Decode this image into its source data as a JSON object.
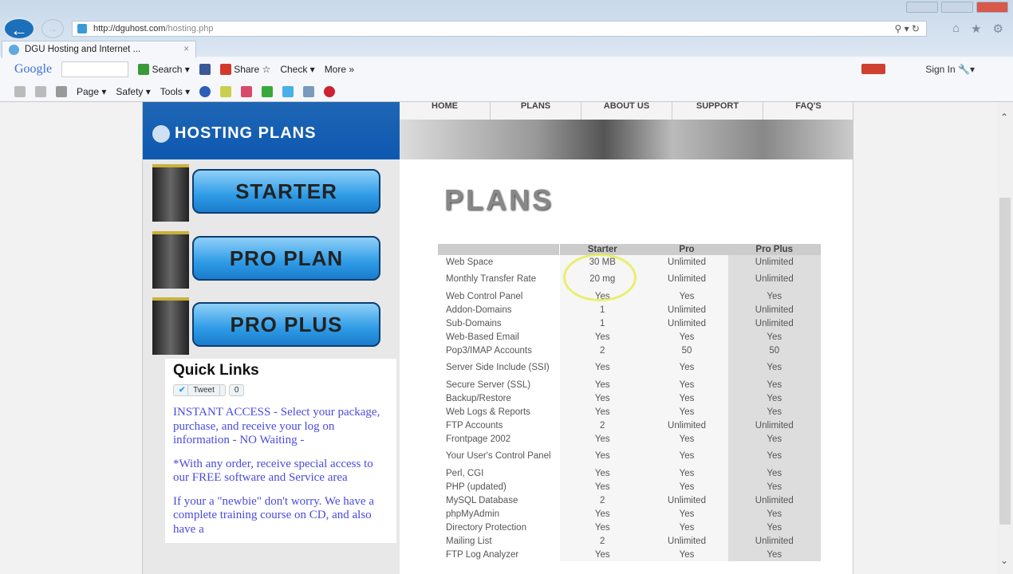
{
  "browser": {
    "url_domain": "http://dguhost.com",
    "url_path": "/hosting.php",
    "tab_title": "DGU Hosting and Internet ...",
    "tab_close": "×",
    "toolbar1": {
      "google": "Google",
      "search": "Search ▾",
      "share": "Share",
      "check": "Check ▾",
      "more": "More »",
      "sign_in": "Sign In"
    },
    "toolbar2": {
      "page": "Page ▾",
      "safety": "Safety ▾",
      "tools": "Tools ▾"
    }
  },
  "site": {
    "header_title": "HOSTING PLANS",
    "nav": [
      "HOME",
      "PLANS",
      "ABOUT US",
      "SUPPORT",
      "FAQ'S"
    ],
    "plan_buttons": [
      "STARTER",
      "PRO PLAN",
      "PRO PLUS"
    ],
    "quick_links": {
      "title": "Quick Links",
      "tweet": "Tweet",
      "tweet_count": "0",
      "paragraphs": [
        "INSTANT ACCESS - Select your package, purchase, and receive your log on information - NO Waiting -",
        "*With any order, receive special access to our FREE software and Service area",
        "If your a \"newbie\" don't worry. We have a complete training course on CD, and also have a"
      ]
    },
    "plans_heading": "PLANS",
    "table": {
      "headers": [
        "",
        "Starter",
        "Pro",
        "Pro Plus"
      ],
      "rows": [
        [
          "Web Space",
          "30 MB",
          "Unlimited",
          "Unlimited"
        ],
        [
          "Monthly Transfer Rate",
          "20 mg",
          "Unlimited",
          "Unlimited"
        ],
        [
          "Web Control Panel",
          "Yes",
          "Yes",
          "Yes"
        ],
        [
          "Addon-Domains",
          "1",
          "Unlimited",
          "Unlimited"
        ],
        [
          "Sub-Domains",
          "1",
          "Unlimited",
          "Unlimited"
        ],
        [
          "Web-Based Email",
          "Yes",
          "Yes",
          "Yes"
        ],
        [
          "Pop3/IMAP Accounts",
          "2",
          "50",
          "50"
        ],
        [
          "Server Side Include (SSI)",
          "Yes",
          "Yes",
          "Yes"
        ],
        [
          "Secure Server (SSL)",
          "Yes",
          "Yes",
          "Yes"
        ],
        [
          "Backup/Restore",
          "Yes",
          "Yes",
          "Yes"
        ],
        [
          "Web Logs & Reports",
          "Yes",
          "Yes",
          "Yes"
        ],
        [
          "FTP Accounts",
          "2",
          "Unlimited",
          "Unlimited"
        ],
        [
          "Frontpage 2002",
          "Yes",
          "Yes",
          "Yes"
        ],
        [
          "Your User's Control Panel",
          "Yes",
          "Yes",
          "Yes"
        ],
        [
          "Perl, CGI",
          "Yes",
          "Yes",
          "Yes"
        ],
        [
          "PHP (updated)",
          "Yes",
          "Yes",
          "Yes"
        ],
        [
          "MySQL Database",
          "2",
          "Unlimited",
          "Unlimited"
        ],
        [
          "phpMyAdmin",
          "Yes",
          "Yes",
          "Yes"
        ],
        [
          "Directory Protection",
          "Yes",
          "Yes",
          "Yes"
        ],
        [
          "Mailing List",
          "2",
          "Unlimited",
          "Unlimited"
        ],
        [
          "FTP Log Analyzer",
          "Yes",
          "Yes",
          "Yes"
        ]
      ]
    }
  }
}
